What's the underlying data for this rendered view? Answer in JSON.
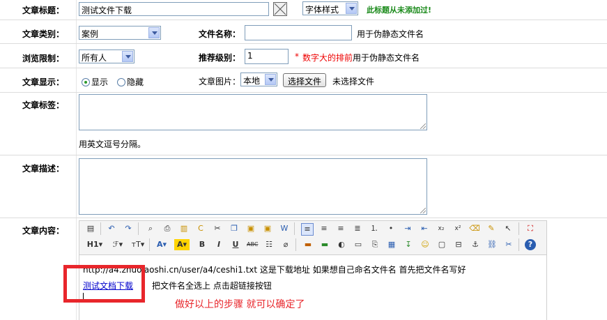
{
  "rows": {
    "title": {
      "label": "文章标题：",
      "value": "测试文件下载",
      "font_select": "字体样式",
      "hint": "此标题从未添加过!"
    },
    "category": {
      "label": "文章类别：",
      "value": "案例",
      "filename_label": "文件名称：",
      "filename_value": "",
      "filename_hint": "用于伪静态文件名"
    },
    "access": {
      "label": "浏览限制：",
      "value": "所有人",
      "rank_label": "推荐级别：",
      "rank_value": "1",
      "rank_star": "*",
      "rank_hint_red": "数字大的排前",
      "rank_hint": "用于伪静态文件名"
    },
    "display": {
      "label": "文章显示：",
      "show_label": "显示",
      "hide_label": "隐藏",
      "image_label": "文章图片：",
      "image_source": "本地",
      "choose_file": "选择文件",
      "no_file": "未选择文件"
    },
    "tags": {
      "label": "文章标签：",
      "hint": "用英文逗号分隔。"
    },
    "description": {
      "label": "文章描述："
    },
    "content": {
      "label": "文章内容："
    }
  },
  "toolbar": {
    "heading": "H1",
    "font": "ℱ",
    "size": "тT",
    "text_color": "A",
    "bg_color": "A",
    "bold": "B",
    "italic": "I",
    "underline": "U",
    "strike": "ABC"
  },
  "editor": {
    "line1": "http://a4.zhuolaoshi.cn/user/a4/ceshi1.txt  这是下载地址 如果想自己命名文件名 首先把文件名写好",
    "link_text": "测试文档下载",
    "line2_rest": "把文件名全选上  点击超链接按钮",
    "annotation": "做好以上的步骤 就可以确定了"
  },
  "colors": {
    "accent_green": "#1a8a1a",
    "hint_red": "#ee0000",
    "annotation_red": "#e8262b",
    "link_blue": "#0000cc"
  }
}
